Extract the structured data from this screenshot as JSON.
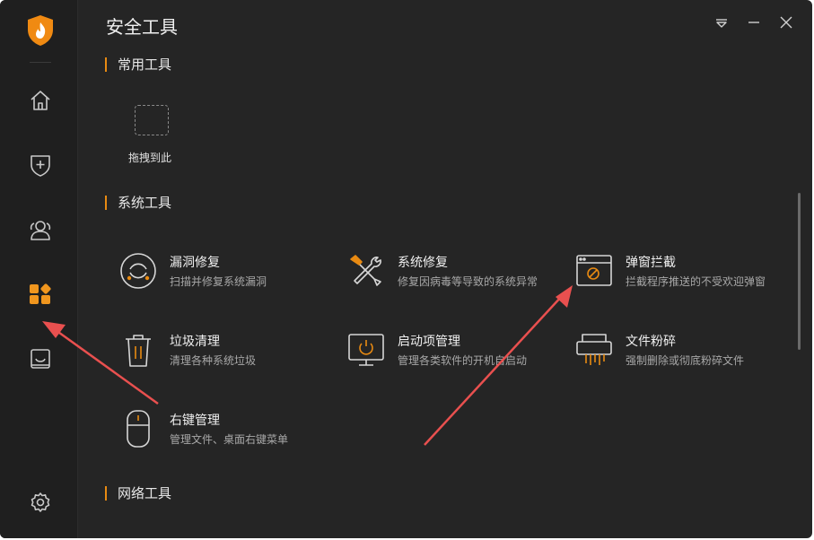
{
  "window": {
    "title": "安全工具"
  },
  "sidebar": {
    "items": [
      {
        "id": "home",
        "icon": "home-icon"
      },
      {
        "id": "protection",
        "icon": "shield-plus-icon"
      },
      {
        "id": "users",
        "icon": "users-icon"
      },
      {
        "id": "tools",
        "icon": "apps-grid-icon",
        "active": true
      },
      {
        "id": "box",
        "icon": "tray-icon"
      },
      {
        "id": "settings",
        "icon": "gear-icon"
      }
    ]
  },
  "sections": {
    "common": {
      "title": "常用工具",
      "drop_label": "拖拽到此"
    },
    "system": {
      "title": "系统工具",
      "tools": [
        {
          "name": "漏洞修复",
          "desc": "扫描并修复系统漏洞",
          "icon": "bug-repair-icon"
        },
        {
          "name": "系统修复",
          "desc": "修复因病毒等导致的系统异常",
          "icon": "wrench-screwdriver-icon"
        },
        {
          "name": "弹窗拦截",
          "desc": "拦截程序推送的不受欢迎弹窗",
          "icon": "popup-block-icon"
        },
        {
          "name": "垃圾清理",
          "desc": "清理各种系统垃圾",
          "icon": "trash-icon"
        },
        {
          "name": "启动项管理",
          "desc": "管理各类软件的开机自启动",
          "icon": "monitor-power-icon"
        },
        {
          "name": "文件粉碎",
          "desc": "强制删除或彻底粉碎文件",
          "icon": "shredder-icon"
        },
        {
          "name": "右键管理",
          "desc": "管理文件、桌面右键菜单",
          "icon": "mouse-icon"
        }
      ]
    },
    "network": {
      "title": "网络工具"
    }
  },
  "colors": {
    "accent": "#e88a12",
    "background": "#252525",
    "sidebar": "#1f1f1f",
    "annotation_arrow": "#e9504f"
  }
}
